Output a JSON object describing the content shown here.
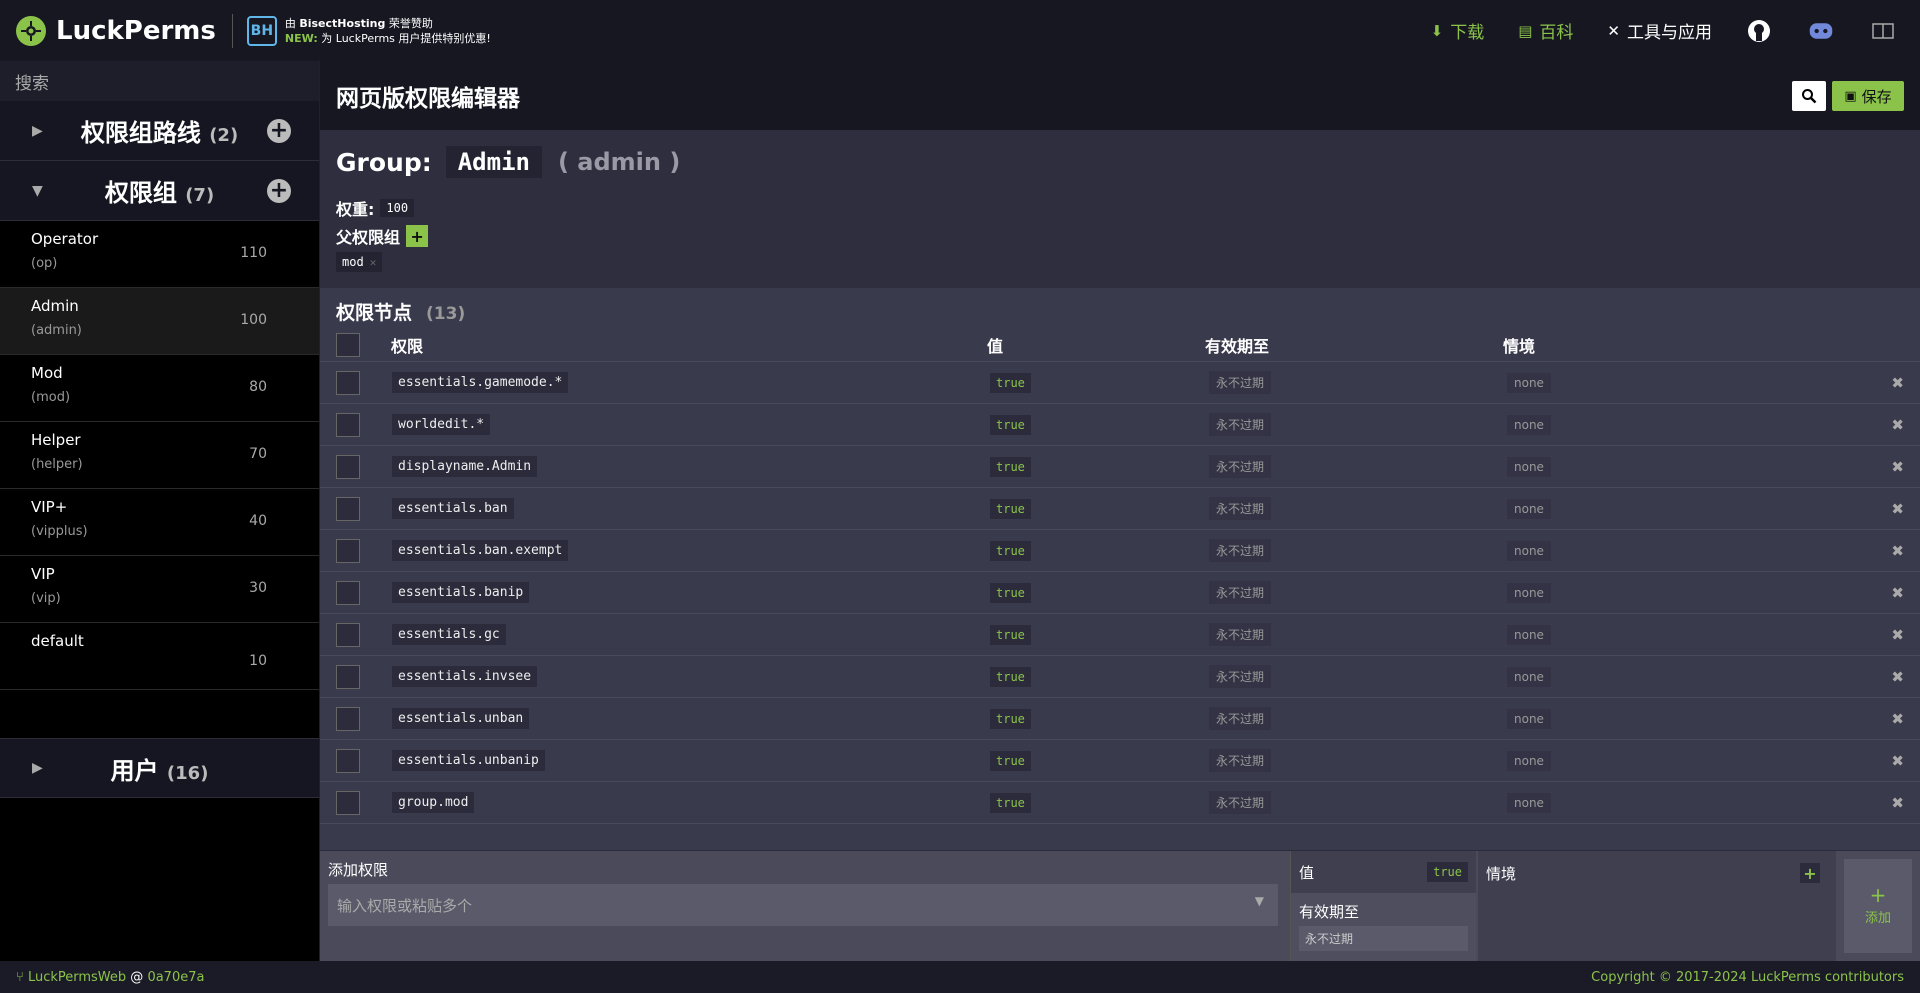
{
  "header": {
    "logo_text": "LuckPerms",
    "sponsor_line1_prefix": "由",
    "sponsor_line1_name": "BisectHosting",
    "sponsor_line1_suffix": "荣誉赞助",
    "sponsor_line2_new": "NEW:",
    "sponsor_line2_text": "为 LuckPerms 用户提供特别优惠!",
    "nav": {
      "download": "下载",
      "wiki": "百科",
      "tools": "工具与应用"
    }
  },
  "sidebar": {
    "search_placeholder": "搜索",
    "tracks": {
      "title": "权限组路线",
      "count": "(2)"
    },
    "groups": {
      "title": "权限组",
      "count": "(7)"
    },
    "group_list": [
      {
        "name": "Operator",
        "id": "(op)",
        "weight": "110"
      },
      {
        "name": "Admin",
        "id": "(admin)",
        "weight": "100"
      },
      {
        "name": "Mod",
        "id": "(mod)",
        "weight": "80"
      },
      {
        "name": "Helper",
        "id": "(helper)",
        "weight": "70"
      },
      {
        "name": "VIP+",
        "id": "(vipplus)",
        "weight": "40"
      },
      {
        "name": "VIP",
        "id": "(vip)",
        "weight": "30"
      },
      {
        "name": "default",
        "id": "",
        "weight": "10"
      }
    ],
    "users": {
      "title": "用户",
      "count": "(16)"
    }
  },
  "main": {
    "page_title": "网页版权限编辑器",
    "save_label": "保存",
    "group": {
      "label": "Group:",
      "name": "Admin",
      "id": "( admin )",
      "weight_label": "权重:",
      "weight": "100",
      "parents_label": "父权限组",
      "parents": [
        "mod"
      ]
    },
    "nodes": {
      "title": "权限节点",
      "count": "(13)",
      "columns": {
        "permission": "权限",
        "value": "值",
        "expiry": "有效期至",
        "context": "情境"
      },
      "rows": [
        {
          "permission": "essentials.gamemode.*",
          "value": "true",
          "expiry": "永不过期",
          "context": "none"
        },
        {
          "permission": "worldedit.*",
          "value": "true",
          "expiry": "永不过期",
          "context": "none"
        },
        {
          "permission": "displayname.Admin",
          "value": "true",
          "expiry": "永不过期",
          "context": "none"
        },
        {
          "permission": "essentials.ban",
          "value": "true",
          "expiry": "永不过期",
          "context": "none"
        },
        {
          "permission": "essentials.ban.exempt",
          "value": "true",
          "expiry": "永不过期",
          "context": "none"
        },
        {
          "permission": "essentials.banip",
          "value": "true",
          "expiry": "永不过期",
          "context": "none"
        },
        {
          "permission": "essentials.gc",
          "value": "true",
          "expiry": "永不过期",
          "context": "none"
        },
        {
          "permission": "essentials.invsee",
          "value": "true",
          "expiry": "永不过期",
          "context": "none"
        },
        {
          "permission": "essentials.unban",
          "value": "true",
          "expiry": "永不过期",
          "context": "none"
        },
        {
          "permission": "essentials.unbanip",
          "value": "true",
          "expiry": "永不过期",
          "context": "none"
        },
        {
          "permission": "group.mod",
          "value": "true",
          "expiry": "永不过期",
          "context": "none"
        }
      ]
    },
    "add": {
      "permission_label": "添加权限",
      "permission_placeholder": "输入权限或粘贴多个",
      "value_label": "值",
      "value": "true",
      "expiry_label": "有效期至",
      "expiry_value": "永不过期",
      "context_label": "情境",
      "add_label": "添加"
    }
  },
  "footer": {
    "repo": "LuckPermsWeb",
    "at": "@",
    "commit": "0a70e7a",
    "copyright": "Copyright © 2017-2024 LuckPerms contributors"
  },
  "colors": {
    "accent": "#8bc34a",
    "header_bg": "#171722",
    "content_bg": "#3a3a4d"
  }
}
